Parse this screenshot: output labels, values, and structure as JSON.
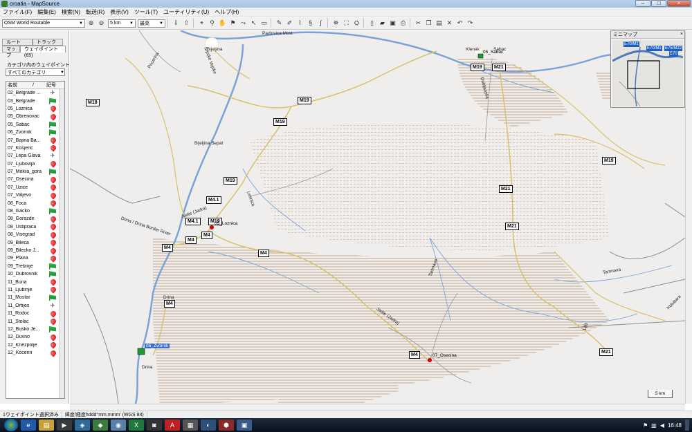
{
  "window": {
    "title": "croatia - MapSource"
  },
  "menu": [
    "ファイル(F)",
    "編集(E)",
    "検索(N)",
    "転送(R)",
    "表示(V)",
    "ツール(T)",
    "ユーティリティ(U)",
    "ヘルプ(H)"
  ],
  "toolbar": {
    "map_product": "OSM World Routable",
    "zoom_scale": "5 km",
    "detail_level": "最高"
  },
  "left_panel": {
    "tabs_top": [
      "ルート",
      "トラック"
    ],
    "tabs_bottom": [
      "マップ",
      "ウェイポイント (65)"
    ],
    "category_label": "カテゴリ内のウェイポイントの表",
    "category_value": "すべてのカテゴリ",
    "columns": {
      "name": "名前",
      "sort": "/",
      "symbol": "記号"
    },
    "waypoints": [
      {
        "name": "02_Belgrade ...",
        "symbol": "plane"
      },
      {
        "name": "03_Belgrade",
        "symbol": "flag"
      },
      {
        "name": "05_Loznica",
        "symbol": "red"
      },
      {
        "name": "05_Obrenovac",
        "symbol": "red"
      },
      {
        "name": "05_Sabac",
        "symbol": "flag"
      },
      {
        "name": "06_Zvornik",
        "symbol": "flag"
      },
      {
        "name": "07_Bajina Ba...",
        "symbol": "red"
      },
      {
        "name": "07_Kosjeric",
        "symbol": "red"
      },
      {
        "name": "07_Lepa Glava",
        "symbol": "plane"
      },
      {
        "name": "07_Ljubovija",
        "symbol": "red"
      },
      {
        "name": "07_Mokra_gora",
        "symbol": "flag"
      },
      {
        "name": "07_Osecina",
        "symbol": "red"
      },
      {
        "name": "07_Uzice",
        "symbol": "red"
      },
      {
        "name": "07_Valjevo",
        "symbol": "red"
      },
      {
        "name": "08_Foca",
        "symbol": "red"
      },
      {
        "name": "08_Gacko",
        "symbol": "flag"
      },
      {
        "name": "08_Gorazde",
        "symbol": "red"
      },
      {
        "name": "08_Ustipraca",
        "symbol": "red"
      },
      {
        "name": "08_Visegrad",
        "symbol": "red"
      },
      {
        "name": "09_Bileca",
        "symbol": "red"
      },
      {
        "name": "09_Bilecko J...",
        "symbol": "red"
      },
      {
        "name": "09_Plana",
        "symbol": "red"
      },
      {
        "name": "09_Trebinje",
        "symbol": "flag"
      },
      {
        "name": "10_Dubrovnik",
        "symbol": "flag"
      },
      {
        "name": "11_Buna",
        "symbol": "red"
      },
      {
        "name": "11_Ljubinje",
        "symbol": "red"
      },
      {
        "name": "11_Mostar",
        "symbol": "flag"
      },
      {
        "name": "11_Ortijes",
        "symbol": "plane"
      },
      {
        "name": "11_Rodoc",
        "symbol": "red"
      },
      {
        "name": "11_Stolac",
        "symbol": "red"
      },
      {
        "name": "12_Busko Je...",
        "symbol": "flag"
      },
      {
        "name": "12_Duvno",
        "symbol": "red"
      },
      {
        "name": "12_Knezpolje",
        "symbol": "red"
      },
      {
        "name": "12_Kocerin",
        "symbol": "red"
      }
    ]
  },
  "map": {
    "roads": [
      "M18",
      "M19",
      "M19",
      "M19",
      "M19",
      "M4.1",
      "M4.1",
      "M19",
      "M4",
      "M4",
      "M4",
      "M4",
      "M4",
      "M21",
      "M21",
      "M21",
      "M19",
      "M21"
    ],
    "places": [
      "Bijeljina",
      "Bijeljina Sepat",
      "Pavlovica Most",
      "Klenak",
      "Sabac",
      "Drina / Drina Border River",
      "Drina",
      "Drina",
      "Jadar (Jadra)",
      "Lesnica",
      "Tamnava",
      "Tamnava",
      "Kolubara",
      "Ljig",
      "Dubljanska",
      "Pocerina",
      "Srpske Vojske",
      "Jadar (Jadra)"
    ],
    "waypoint_labels": [
      "05_Loznica",
      "06_Zvornik",
      "07_Osecina",
      "05_Sabac"
    ],
    "scale": "5 km"
  },
  "minimap": {
    "title": "ミニマップ",
    "close": "×",
    "shields": [
      "E70/M1",
      "E70/M1",
      "E75/M22",
      "E70"
    ]
  },
  "status": {
    "selection": "1ウェイポイント選択済み",
    "coords": "緯度/経度hddd°mm.mmm' (WGS 84)"
  },
  "taskbar": {
    "time": "16:48"
  },
  "colors": {
    "river": "#7aa2d8",
    "major_road": "#d8c06a",
    "minor_road": "#9a9a9a",
    "hatch": "#b89478",
    "waypoint_red": "#d00000",
    "waypoint_green": "#1e9a3a"
  }
}
